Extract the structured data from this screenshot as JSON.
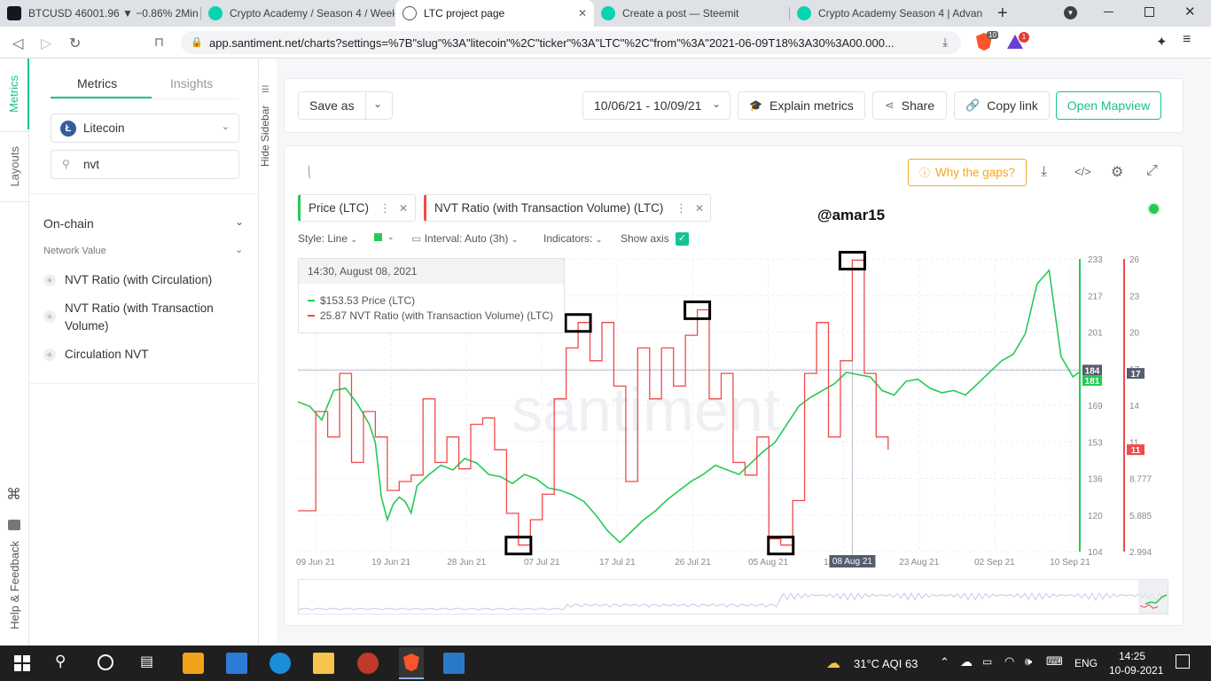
{
  "browser": {
    "tabs": [
      {
        "title": "BTCUSD 46001.96 ▼ −0.86% 2Min",
        "favicon_color": "#131722"
      },
      {
        "title": "Crypto Academy / Season 4 / Week",
        "favicon_color": "#07d4b0"
      },
      {
        "title": "LTC project page",
        "favicon_color": "#555555"
      },
      {
        "title": "Create a post — Steemit",
        "favicon_color": "#07d4b0"
      },
      {
        "title": "Crypto Academy Season 4 | Advan",
        "favicon_color": "#07d4b0"
      }
    ],
    "url": "app.santiment.net/charts?settings=%7B\"slug\"%3A\"litecoin\"%2C\"ticker\"%3A\"LTC\"%2C\"from\"%3A\"2021-06-09T18%3A30%3A00.000...",
    "brave_count": "10",
    "alert_count": "1"
  },
  "vertical_tabs": {
    "metrics": "Metrics",
    "layouts": "Layouts",
    "help": "Help & Feedback"
  },
  "sidebar": {
    "tabs": {
      "metrics": "Metrics",
      "insights": "Insights"
    },
    "asset": "Litecoin",
    "search_value": "nvt",
    "section": "On-chain",
    "subsection": "Network Value",
    "items": [
      "NVT Ratio (with Circulation)",
      "NVT Ratio (with Transaction Volume)",
      "Circulation NVT"
    ],
    "hide_label": "Hide Sidebar"
  },
  "toolbar": {
    "save_as": "Save as",
    "date_range": "10/06/21 - 10/09/21",
    "explain": "Explain metrics",
    "share": "Share",
    "copy_link": "Copy link",
    "open_mapview": "Open Mapview"
  },
  "chart_panel": {
    "why_gaps": "Why the gaps?",
    "watermark": "santiment",
    "annotation": "@amar15",
    "metric_chips": [
      "Price (LTC)",
      "NVT Ratio (with Transaction Volume) (LTC)"
    ],
    "options": {
      "style": "Style: Line",
      "interval": "Interval: Auto (3h)",
      "indicators": "Indicators:",
      "show_axis": "Show axis"
    },
    "tooltip": {
      "date": "14:30, August 08, 2021",
      "price_line": "$153.53 Price (LTC)",
      "nvt_line": "25.87 NVT Ratio (with Transaction Volume) (LTC)"
    },
    "left_axis_badges": {
      "price_hover": "184",
      "price_current": "181"
    },
    "right_axis_badges": {
      "nvt_hover": "17",
      "nvt_current": "11"
    },
    "hover_date_badge": "08 Aug 21"
  },
  "chart_data": {
    "type": "line",
    "x_labels": [
      "09 Jun 21",
      "19 Jun 21",
      "28 Jun 21",
      "07 Jul 21",
      "17 Jul 21",
      "26 Jul 21",
      "05 Aug 21",
      "14 Aug 21",
      "23 Aug 21",
      "02 Sep 21",
      "10 Sep 21"
    ],
    "price_axis_ticks": [
      "233",
      "217",
      "201",
      "185",
      "169",
      "153",
      "136",
      "120",
      "104"
    ],
    "nvt_axis_ticks": [
      "26",
      "23",
      "20",
      "17",
      "14",
      "11",
      "8.777",
      "5.885",
      "2.994"
    ],
    "price_ylim": [
      104,
      233
    ],
    "nvt_ylim": [
      2.994,
      26
    ],
    "series": [
      {
        "name": "Price (LTC)",
        "color": "#26c953",
        "points": [
          [
            0,
            170
          ],
          [
            2,
            168
          ],
          [
            4,
            162
          ],
          [
            6,
            175
          ],
          [
            8,
            176
          ],
          [
            10,
            169
          ],
          [
            12,
            160
          ],
          [
            13,
            152
          ],
          [
            14,
            128
          ],
          [
            15,
            118
          ],
          [
            16,
            125
          ],
          [
            17,
            128
          ],
          [
            18,
            126
          ],
          [
            19,
            121
          ],
          [
            20,
            133
          ],
          [
            22,
            138
          ],
          [
            24,
            142
          ],
          [
            26,
            140
          ],
          [
            28,
            145
          ],
          [
            30,
            143
          ],
          [
            32,
            138
          ],
          [
            34,
            137
          ],
          [
            36,
            134
          ],
          [
            38,
            138
          ],
          [
            40,
            136
          ],
          [
            42,
            132
          ],
          [
            44,
            131
          ],
          [
            46,
            129
          ],
          [
            48,
            126
          ],
          [
            50,
            120
          ],
          [
            52,
            113
          ],
          [
            54,
            108
          ],
          [
            56,
            113
          ],
          [
            58,
            118
          ],
          [
            60,
            122
          ],
          [
            62,
            127
          ],
          [
            64,
            131
          ],
          [
            66,
            135
          ],
          [
            68,
            138
          ],
          [
            70,
            142
          ],
          [
            72,
            140
          ],
          [
            74,
            138
          ],
          [
            76,
            143
          ],
          [
            78,
            148
          ],
          [
            80,
            152
          ],
          [
            82,
            160
          ],
          [
            84,
            168
          ],
          [
            86,
            172
          ],
          [
            88,
            175
          ],
          [
            90,
            178
          ],
          [
            92,
            183
          ],
          [
            94,
            182
          ],
          [
            96,
            181
          ],
          [
            98,
            175
          ],
          [
            100,
            173
          ],
          [
            102,
            179
          ],
          [
            104,
            180
          ],
          [
            106,
            176
          ],
          [
            108,
            174
          ],
          [
            110,
            175
          ],
          [
            112,
            173
          ],
          [
            114,
            178
          ],
          [
            116,
            183
          ],
          [
            118,
            188
          ],
          [
            120,
            191
          ],
          [
            122,
            200
          ],
          [
            124,
            222
          ],
          [
            126,
            228
          ],
          [
            128,
            190
          ],
          [
            130,
            181
          ],
          [
            131,
            183
          ]
        ]
      },
      {
        "name": "NVT Ratio (with Transaction Volume) (LTC)",
        "color": "#f04a4a",
        "points": [
          [
            0,
            6.2
          ],
          [
            2,
            6.2
          ],
          [
            3,
            14
          ],
          [
            5,
            12
          ],
          [
            7,
            17
          ],
          [
            9,
            10
          ],
          [
            11,
            14
          ],
          [
            13,
            12
          ],
          [
            15,
            7.8
          ],
          [
            17,
            8.5
          ],
          [
            19,
            9
          ],
          [
            21,
            15
          ],
          [
            23,
            10
          ],
          [
            25,
            12
          ],
          [
            27,
            9.5
          ],
          [
            29,
            13
          ],
          [
            31,
            13.5
          ],
          [
            33,
            11
          ],
          [
            35,
            6
          ],
          [
            37,
            3.5
          ],
          [
            39,
            5.5
          ],
          [
            41,
            7.5
          ],
          [
            43,
            15
          ],
          [
            45,
            19
          ],
          [
            47,
            21
          ],
          [
            49,
            18
          ],
          [
            51,
            21
          ],
          [
            53,
            16
          ],
          [
            55,
            8.5
          ],
          [
            57,
            19
          ],
          [
            59,
            15
          ],
          [
            61,
            19
          ],
          [
            63,
            16
          ],
          [
            65,
            20
          ],
          [
            67,
            22
          ],
          [
            69,
            15
          ],
          [
            71,
            17
          ],
          [
            73,
            10
          ],
          [
            75,
            9
          ],
          [
            77,
            12
          ],
          [
            79,
            4
          ],
          [
            81,
            3.5
          ],
          [
            83,
            7
          ],
          [
            85,
            17
          ],
          [
            87,
            21
          ],
          [
            89,
            12
          ],
          [
            91,
            18
          ],
          [
            93,
            25.9
          ],
          [
            95,
            17
          ],
          [
            97,
            12
          ],
          [
            99,
            11
          ]
        ]
      }
    ],
    "index_to_x_label": "points are sampled from 09 Jun 21 (index 0) to 10 Sep 21 (index 131)"
  },
  "system_tray": {
    "weather": "31°C  AQI 63",
    "language": "ENG",
    "time": "14:25",
    "date": "10-09-2021"
  }
}
